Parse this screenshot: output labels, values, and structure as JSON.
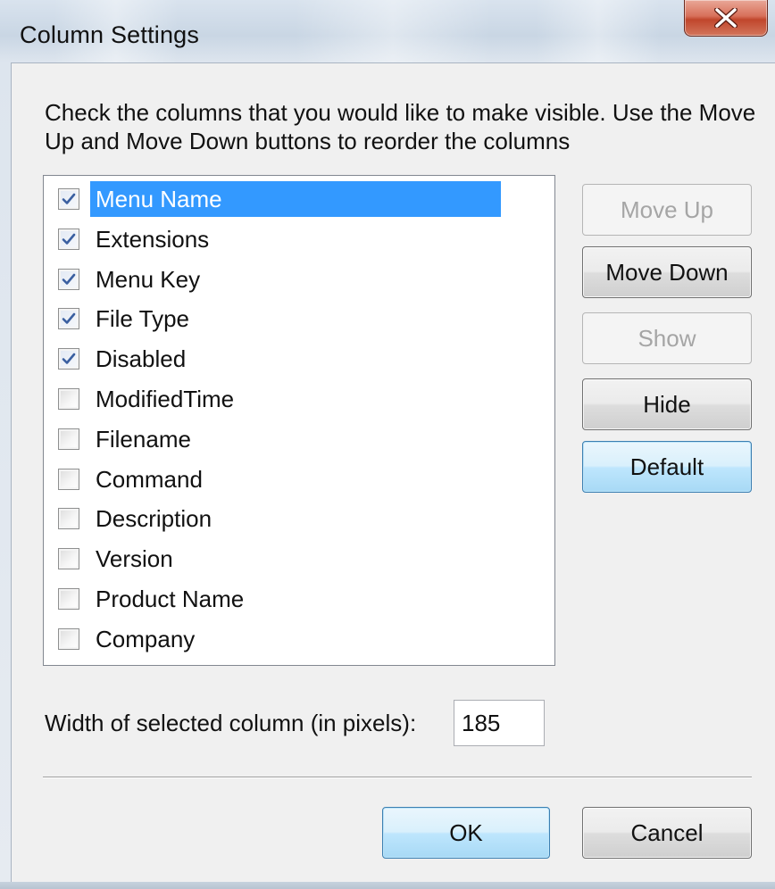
{
  "window": {
    "title": "Column Settings"
  },
  "instructions": "Check the columns that you would like to make visible. Use the Move Up and Move Down buttons to reorder the columns",
  "columns": [
    {
      "label": "Menu Name",
      "checked": true,
      "selected": true
    },
    {
      "label": "Extensions",
      "checked": true,
      "selected": false
    },
    {
      "label": "Menu Key",
      "checked": true,
      "selected": false
    },
    {
      "label": "File Type",
      "checked": true,
      "selected": false
    },
    {
      "label": "Disabled",
      "checked": true,
      "selected": false
    },
    {
      "label": "ModifiedTime",
      "checked": false,
      "selected": false
    },
    {
      "label": "Filename",
      "checked": false,
      "selected": false
    },
    {
      "label": "Command",
      "checked": false,
      "selected": false
    },
    {
      "label": "Description",
      "checked": false,
      "selected": false
    },
    {
      "label": "Version",
      "checked": false,
      "selected": false
    },
    {
      "label": "Product Name",
      "checked": false,
      "selected": false
    },
    {
      "label": "Company",
      "checked": false,
      "selected": false
    }
  ],
  "side_buttons": {
    "move_up": {
      "label": "Move Up",
      "enabled": false
    },
    "move_down": {
      "label": "Move Down",
      "enabled": true
    },
    "show": {
      "label": "Show",
      "enabled": false
    },
    "hide": {
      "label": "Hide",
      "enabled": true
    },
    "default": {
      "label": "Default",
      "enabled": true
    }
  },
  "width_field": {
    "label": "Width of selected column (in pixels):",
    "value": "185"
  },
  "footer": {
    "ok_label": "OK",
    "cancel_label": "Cancel"
  },
  "colors": {
    "selection": "#3399ff",
    "close_button": "#c7462c",
    "check_mark": "#3a5fa0"
  },
  "icons": {
    "close": "close-icon",
    "check": "check-icon"
  }
}
